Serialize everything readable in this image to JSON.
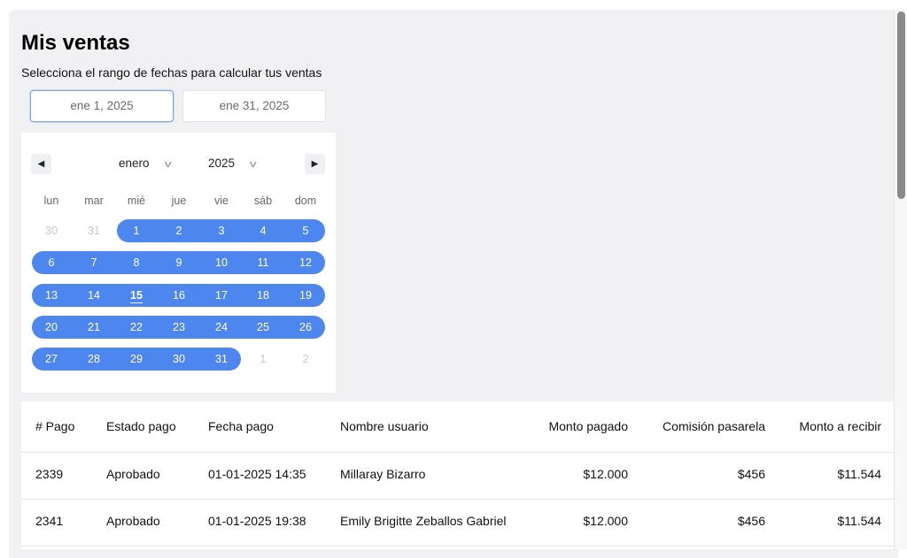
{
  "page": {
    "title": "Mis ventas",
    "subtitle": "Selecciona el rango de fechas para calcular tus ventas"
  },
  "date_range": {
    "start": "ene 1, 2025",
    "end": "ene 31, 2025"
  },
  "calendar": {
    "month": "enero",
    "year": "2025",
    "weekdays": [
      "lun",
      "mar",
      "mié",
      "jue",
      "vie",
      "sáb",
      "dom"
    ],
    "weeks": [
      [
        "30",
        "31",
        "1",
        "2",
        "3",
        "4",
        "5"
      ],
      [
        "6",
        "7",
        "8",
        "9",
        "10",
        "11",
        "12"
      ],
      [
        "13",
        "14",
        "15",
        "16",
        "17",
        "18",
        "19"
      ],
      [
        "20",
        "21",
        "22",
        "23",
        "24",
        "25",
        "26"
      ],
      [
        "27",
        "28",
        "29",
        "30",
        "31",
        "1",
        "2"
      ]
    ],
    "today": "15",
    "colors": {
      "range": "#4d86ee",
      "outside_day": "#c8c8cc"
    }
  },
  "table": {
    "columns": [
      "# Pago",
      "Estado pago",
      "Fecha pago",
      "Nombre usuario",
      "Monto pagado",
      "Comisión pasarela",
      "Monto a recibir"
    ],
    "rows": [
      [
        "2339",
        "Aprobado",
        "01-01-2025 14:35",
        "Millaray Bizarro",
        "$12.000",
        "$456",
        "$11.544"
      ],
      [
        "2341",
        "Aprobado",
        "01-01-2025 19:38",
        "Emily Brigitte Zeballos Gabriel",
        "$12.000",
        "$456",
        "$11.544"
      ]
    ]
  }
}
